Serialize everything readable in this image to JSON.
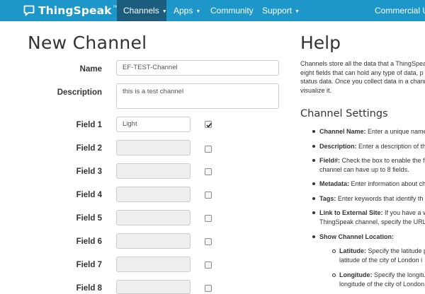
{
  "nav": {
    "brand": "ThingSpeak",
    "brand_tm": "™",
    "items": [
      {
        "label": "Channels",
        "caret": "▼"
      },
      {
        "label": "Apps",
        "caret": "▼"
      },
      {
        "label": "Community"
      },
      {
        "label": "Support",
        "caret": "▼"
      },
      {
        "label": "Commercial Use"
      }
    ]
  },
  "form": {
    "title": "New Channel",
    "name_label": "Name",
    "name_value": "EF-TEST-Channel",
    "description_label": "Description",
    "description_value": "this is a test channel",
    "fields": [
      {
        "label": "Field 1",
        "value": "Light",
        "checked": true
      },
      {
        "label": "Field 2",
        "value": "",
        "checked": false
      },
      {
        "label": "Field 3",
        "value": "",
        "checked": false
      },
      {
        "label": "Field 4",
        "value": "",
        "checked": false
      },
      {
        "label": "Field 5",
        "value": "",
        "checked": false
      },
      {
        "label": "Field 6",
        "value": "",
        "checked": false
      },
      {
        "label": "Field 7",
        "value": "",
        "checked": false
      },
      {
        "label": "Field 8",
        "value": "",
        "checked": false
      }
    ]
  },
  "help": {
    "title": "Help",
    "intro_lines": [
      "Channels store all the data that a ThingSpeak",
      "eight fields that can hold any type of data, p",
      "status data. Once you collect data in a chann",
      "visualize it."
    ],
    "settings_title": "Channel Settings",
    "bullets": [
      {
        "term": "Channel Name:",
        "lines": [
          " Enter a unique name"
        ]
      },
      {
        "term": "Description:",
        "lines": [
          " Enter a description of th"
        ]
      },
      {
        "term": "Field#:",
        "lines": [
          " Check the box to enable the fi",
          "channel can have up to 8 fields."
        ]
      },
      {
        "term": "Metadata:",
        "lines": [
          " Enter information about ch"
        ]
      },
      {
        "term": "Tags:",
        "lines": [
          " Enter keywords that identify th"
        ]
      },
      {
        "term": "Link to External Site:",
        "lines": [
          " If you have a we",
          "ThingSpeak channel, specify the URL"
        ]
      },
      {
        "term": "Show Channel Location:",
        "lines": [
          ""
        ]
      }
    ],
    "sub_bullets": [
      {
        "term": "Latitude:",
        "lines": [
          " Specify the latitude p",
          "latitude of the city of London i"
        ]
      },
      {
        "term": "Longitude:",
        "lines": [
          " Specify the longitu",
          "longitude of the city of London"
        ]
      }
    ]
  },
  "colors": {
    "navbar": "#1d97c9",
    "nav_active": "#1c5d7e"
  }
}
